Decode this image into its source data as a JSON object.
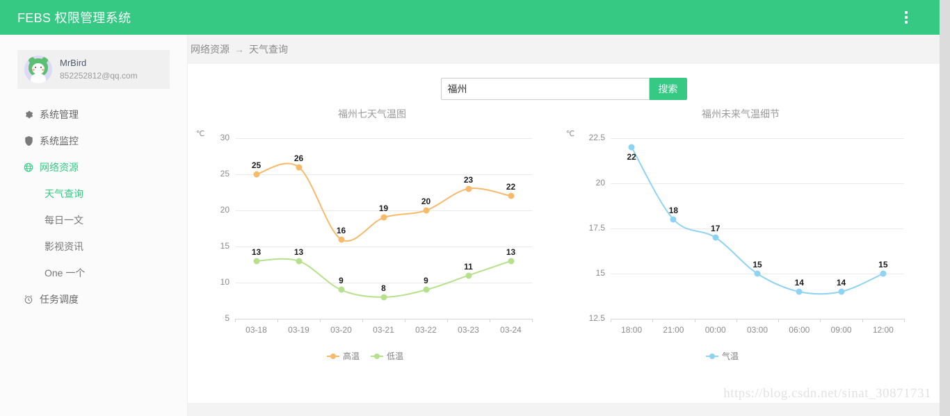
{
  "topbar": {
    "title": "FEBS 权限管理系统",
    "menu_icon": "vertical-dots-icon",
    "bg": "#35c984"
  },
  "sidebar": {
    "user": {
      "name": "MrBird",
      "email": "852252812@qq.com",
      "avatar_icon": "frog-hood-cat-avatar"
    },
    "items": [
      {
        "label": "系统管理",
        "icon": "gear-icon",
        "active": false
      },
      {
        "label": "系统监控",
        "icon": "shield-icon",
        "active": false
      },
      {
        "label": "网络资源",
        "icon": "globe-icon",
        "active": true
      }
    ],
    "sub_items": [
      {
        "label": "天气查询",
        "active": true
      },
      {
        "label": "每日一文",
        "active": false
      },
      {
        "label": "影视资讯",
        "active": false
      },
      {
        "label": "One 一个",
        "active": false
      }
    ],
    "items_after": [
      {
        "label": "任务调度",
        "icon": "alarm-clock-icon",
        "active": false
      }
    ]
  },
  "breadcrumb": {
    "parent": "网络资源",
    "separator": "→",
    "current": "天气查询"
  },
  "search": {
    "value": "福州",
    "placeholder": "",
    "button_label": "搜索",
    "button_color": "#35c984"
  },
  "watermark": "https://blog.csdn.net/sinat_30871731",
  "chart_data": [
    {
      "type": "line",
      "id": "seven-day-temperature",
      "title": "福州七天气温图",
      "unit_label": "℃",
      "xlabel": "",
      "ylabel": "℃",
      "categories": [
        "03-18",
        "03-19",
        "03-20",
        "03-21",
        "03-22",
        "03-23",
        "03-24"
      ],
      "yticks": [
        5,
        10,
        15,
        20,
        25,
        30
      ],
      "ylim": [
        5,
        30
      ],
      "grid": true,
      "legend_position": "bottom",
      "smooth": true,
      "series": [
        {
          "name": "高温",
          "color": "#fac858",
          "line_color": "#f7b96a",
          "values": [
            25,
            26,
            16,
            19,
            20,
            23,
            22
          ]
        },
        {
          "name": "低温",
          "color": "#b5e08c",
          "line_color": "#b5e08c",
          "values": [
            13,
            13,
            9,
            8,
            9,
            11,
            13
          ]
        }
      ]
    },
    {
      "type": "line",
      "id": "future-temperature-detail",
      "title": "福州未来气温细节",
      "unit_label": "℃",
      "xlabel": "",
      "ylabel": "℃",
      "categories": [
        "18:00",
        "21:00",
        "00:00",
        "03:00",
        "06:00",
        "09:00",
        "12:00"
      ],
      "yticks": [
        12.5,
        15,
        17.5,
        20,
        22.5
      ],
      "ylim": [
        12.5,
        22.5
      ],
      "grid": true,
      "legend_position": "bottom",
      "smooth": true,
      "series": [
        {
          "name": "气温",
          "color": "#8fd3f4",
          "line_color": "#8fd3f4",
          "values": [
            22,
            18,
            17,
            15,
            14,
            14,
            15
          ]
        }
      ]
    }
  ]
}
